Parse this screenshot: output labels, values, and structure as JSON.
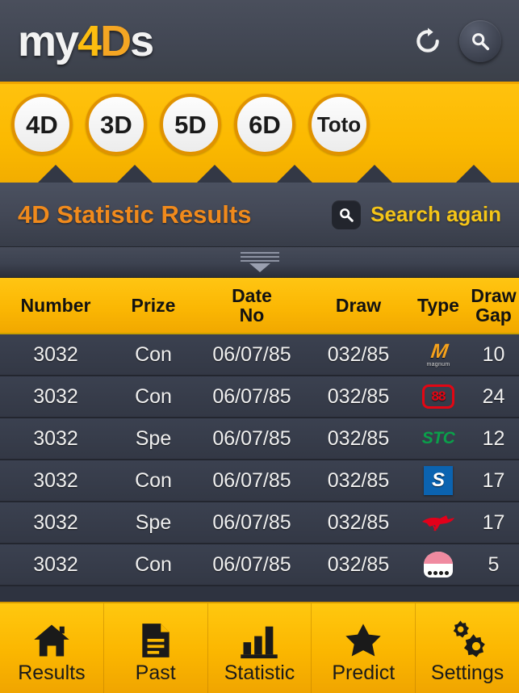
{
  "header": {
    "logo_white_1": "my",
    "logo_yellow": "4",
    "logo_orange": "D",
    "logo_white_2": "s",
    "refresh_icon": "refresh-icon",
    "search_icon": "search-icon"
  },
  "tabs": [
    {
      "label": "4D",
      "active": true
    },
    {
      "label": "3D",
      "active": false
    },
    {
      "label": "5D",
      "active": false
    },
    {
      "label": "6D",
      "active": false
    },
    {
      "label": "Toto",
      "active": false
    }
  ],
  "title_bar": {
    "title": "4D Statistic Results",
    "search_again_label": "Search again",
    "search_again_icon": "search-icon"
  },
  "handle": {
    "icon": "collapse-handle-icon"
  },
  "table": {
    "columns": [
      {
        "key": "number",
        "label": "Number"
      },
      {
        "key": "prize",
        "label": "Prize"
      },
      {
        "key": "date",
        "label_line1": "Date",
        "label_line2": "No"
      },
      {
        "key": "draw",
        "label": "Draw"
      },
      {
        "key": "type",
        "label": "Type"
      },
      {
        "key": "gap",
        "label_line1": "Draw",
        "label_line2": "Gap"
      }
    ],
    "rows": [
      {
        "number": "3032",
        "prize": "Con",
        "date": "06/07/85",
        "draw": "032/85",
        "type": "magnum",
        "gap": "10"
      },
      {
        "number": "3032",
        "prize": "Con",
        "date": "06/07/85",
        "draw": "032/85",
        "type": "damacai",
        "gap": "24"
      },
      {
        "number": "3032",
        "prize": "Spe",
        "date": "06/07/85",
        "draw": "032/85",
        "type": "stc",
        "gap": "12"
      },
      {
        "number": "3032",
        "prize": "Con",
        "date": "06/07/85",
        "draw": "032/85",
        "type": "sabah",
        "gap": "17"
      },
      {
        "number": "3032",
        "prize": "Spe",
        "date": "06/07/85",
        "draw": "032/85",
        "type": "cashsweep",
        "gap": "17"
      },
      {
        "number": "3032",
        "prize": "Con",
        "date": "06/07/85",
        "draw": "032/85",
        "type": "sandakan",
        "gap": "5"
      }
    ],
    "logo_text": {
      "magnum_mark": "M",
      "magnum_word": "magnum",
      "damacai_mark": "88",
      "stc_mark": "STC",
      "sabah_mark": "S"
    }
  },
  "bottom_nav": [
    {
      "label": "Results",
      "icon": "home-icon"
    },
    {
      "label": "Past",
      "icon": "document-icon"
    },
    {
      "label": "Statistic",
      "icon": "bar-chart-icon"
    },
    {
      "label": "Predict",
      "icon": "star-icon"
    },
    {
      "label": "Settings",
      "icon": "gears-icon"
    }
  ],
  "colors": {
    "accent_yellow": "#fbb900",
    "accent_orange": "#f08a1c",
    "dark_slate": "#333845",
    "header_gray": "#434855"
  }
}
